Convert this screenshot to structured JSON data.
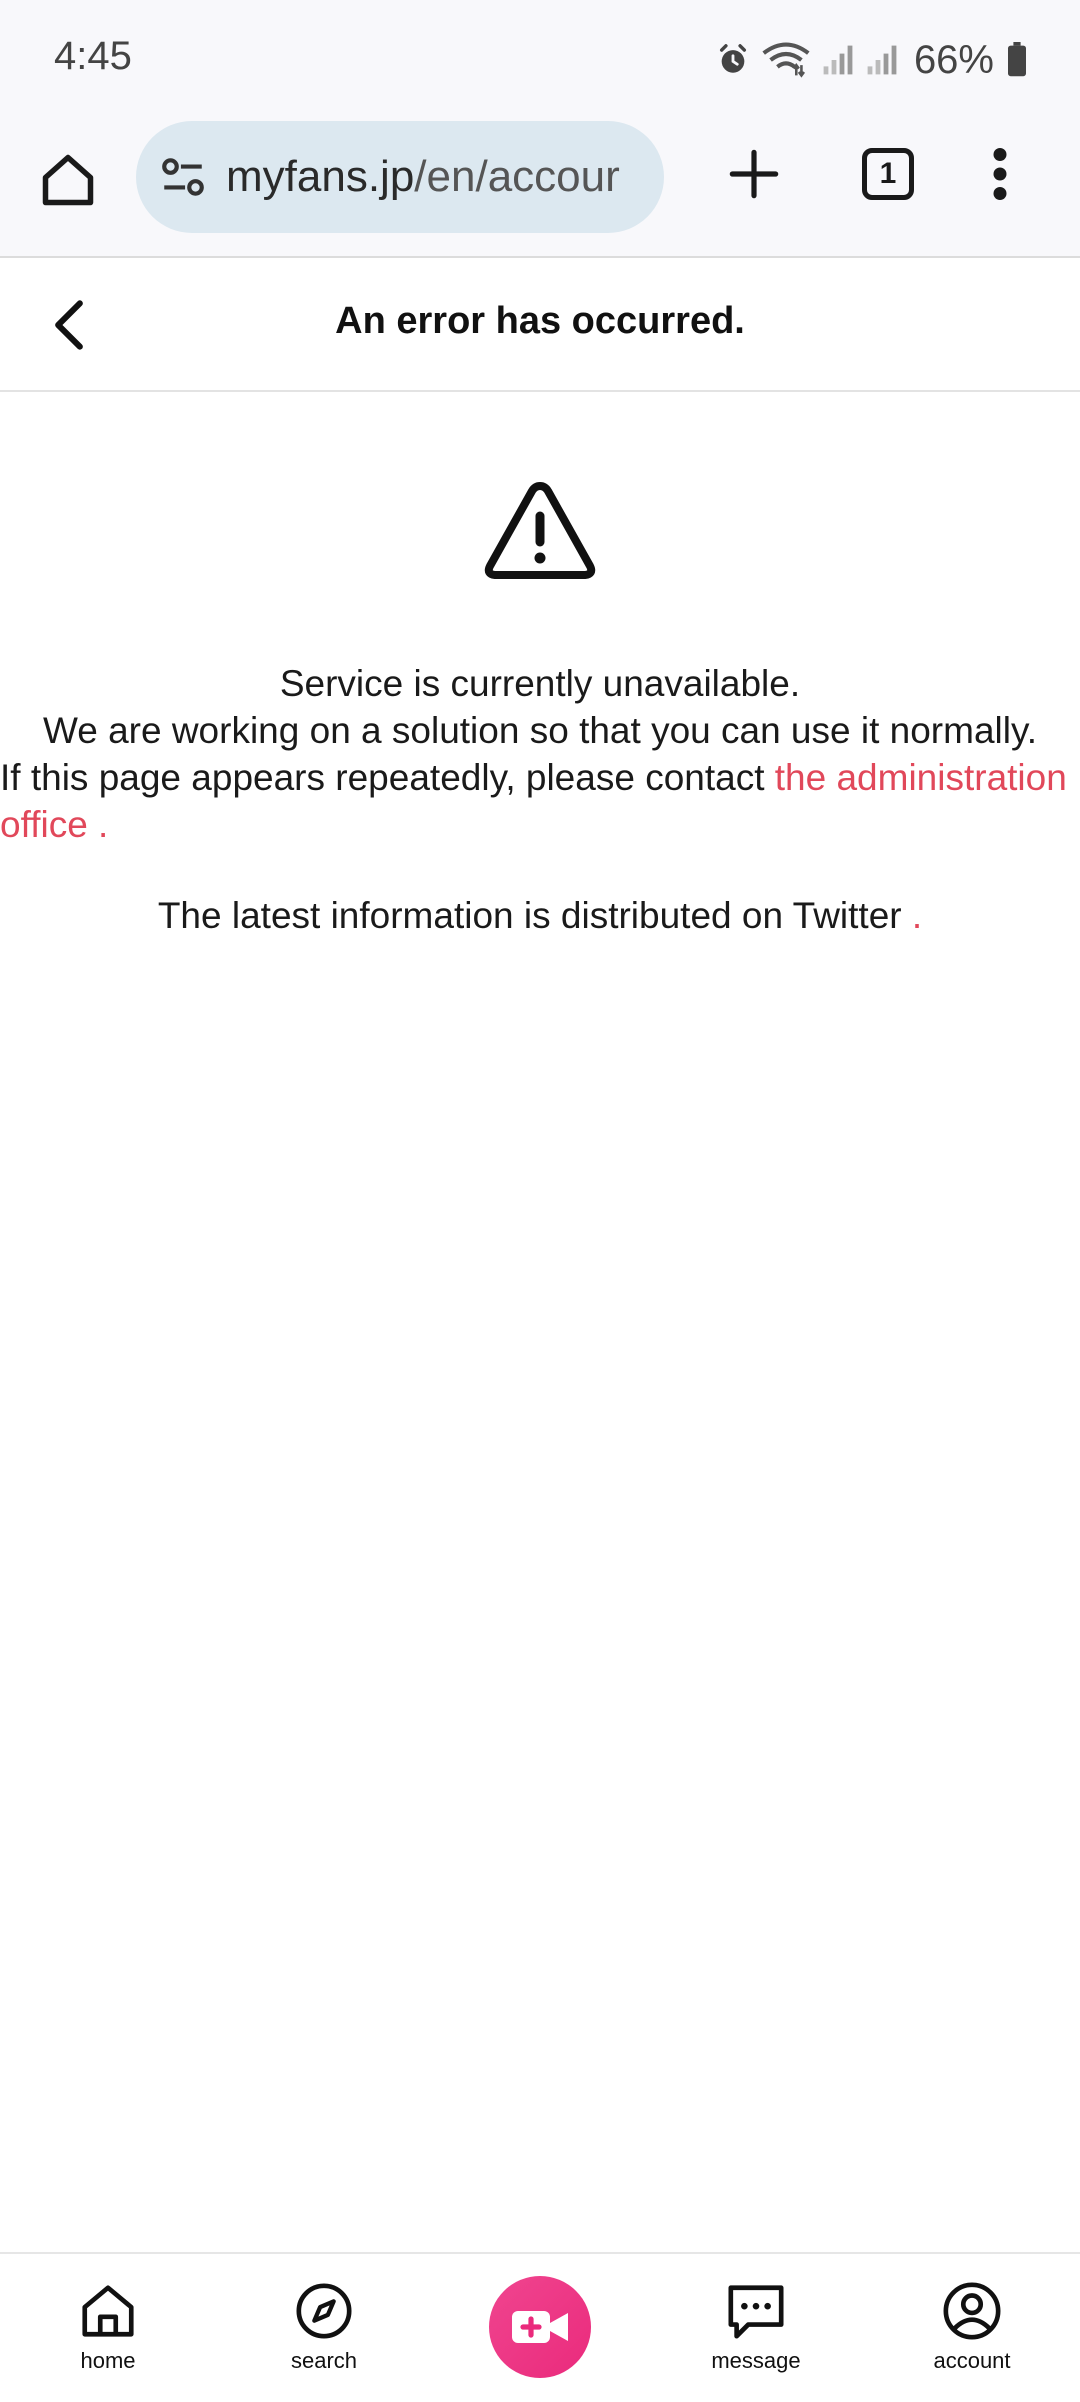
{
  "status_bar": {
    "time": "4:45",
    "battery": "66%",
    "icons": [
      "alarm-icon",
      "wifi-icon",
      "signal-icon",
      "signal-icon",
      "battery-icon"
    ]
  },
  "browser": {
    "url_host": "myfans.jp",
    "url_rest": "/en/accour",
    "tab_count": "1"
  },
  "header": {
    "title": "An error has occurred."
  },
  "content": {
    "line1": "Service is currently unavailable.",
    "line2": "We are working on a solution so that you can use it normally.",
    "line3_prefix": "If this page appears repeatedly, please contact ",
    "contact_link": "the administration office .",
    "twitter_text": "The latest information is distributed on Twitter ",
    "twitter_link": "."
  },
  "colors": {
    "accent": "#e1485a",
    "center_button": "#ea2a7c"
  },
  "bottom_nav": {
    "home": "home",
    "search": "search",
    "message": "message",
    "account": "account"
  }
}
